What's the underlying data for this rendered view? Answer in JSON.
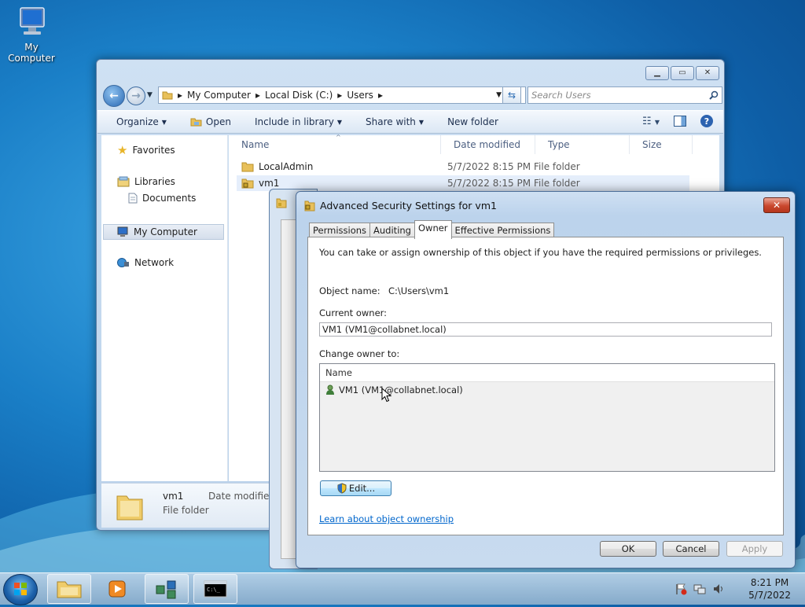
{
  "desktop": {
    "icon_label": "My Computer"
  },
  "explorer": {
    "address": [
      "My Computer",
      "Local Disk (C:)",
      "Users"
    ],
    "search_placeholder": "Search Users",
    "toolbar": {
      "organize": "Organize",
      "open": "Open",
      "include_in_library": "Include in library",
      "share_with": "Share with",
      "new_folder": "New folder"
    },
    "nav": {
      "favorites": "Favorites",
      "libraries": "Libraries",
      "documents": "Documents",
      "my_computer": "My Computer",
      "network": "Network"
    },
    "columns": {
      "name": "Name",
      "date": "Date modified",
      "type": "Type",
      "size": "Size"
    },
    "files": [
      {
        "name": "LocalAdmin",
        "date": "5/7/2022 8:15 PM",
        "type": "File folder"
      },
      {
        "name": "vm1",
        "date": "5/7/2022 8:15 PM",
        "type": "File folder"
      }
    ],
    "details": {
      "name": "vm1",
      "type": "File folder",
      "date_label": "Date modified:"
    }
  },
  "dialog": {
    "title": "Advanced Security Settings for vm1",
    "tabs": [
      "Permissions",
      "Auditing",
      "Owner",
      "Effective Permissions"
    ],
    "active_tab": "Owner",
    "intro": "You can take or assign ownership of this object if you have the required permissions or privileges.",
    "object_name_label": "Object name:",
    "object_name_value": "C:\\Users\\vm1",
    "current_owner_label": "Current owner:",
    "current_owner_value": "VM1 (VM1@collabnet.local)",
    "change_owner_label": "Change owner to:",
    "list_header": "Name",
    "list_items": [
      "VM1 (VM1@collabnet.local)"
    ],
    "edit_button": "Edit...",
    "learn_link": "Learn about object ownership",
    "ok": "OK",
    "cancel": "Cancel",
    "apply": "Apply"
  },
  "taskbar": {
    "time": "8:21 PM",
    "date": "5/7/2022"
  }
}
